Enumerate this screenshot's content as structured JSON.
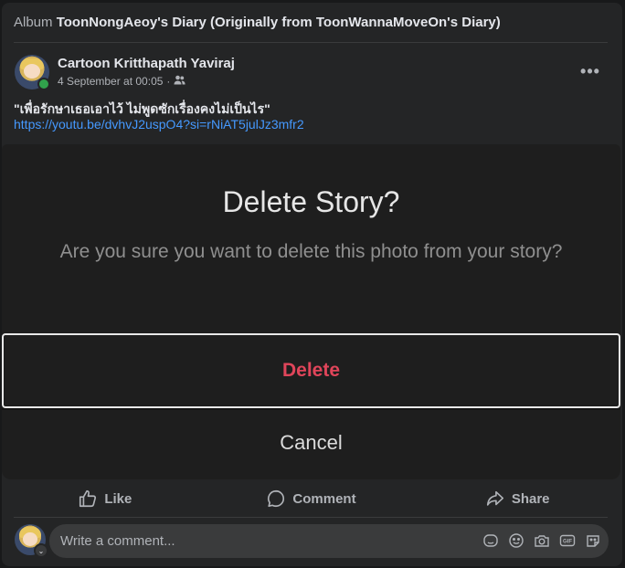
{
  "header": {
    "album_prefix": "Album",
    "album_name": "ToonNongAeoy's Diary (Originally from ToonWannaMoveOn's Diary)"
  },
  "post": {
    "author": "Cartoon Kritthapath Yaviraj",
    "date": "4 September at 00:05",
    "meta_separator": "·",
    "audience_icon": "friends-icon",
    "text": "\"เพื่อรักษาเธอเอาไว้ ไม่พูดซักเรื่องคงไม่เป็นไร\"",
    "link": "https://youtu.be/dvhvJ2uspO4?si=rNiAT5julJz3mfr2",
    "more_label": "•••"
  },
  "dialog": {
    "title": "Delete Story?",
    "message": "Are you sure you want to delete this photo from your story?",
    "delete_label": "Delete",
    "cancel_label": "Cancel",
    "delete_color": "#e0455a"
  },
  "actions": {
    "like": "Like",
    "comment": "Comment",
    "share": "Share"
  },
  "comment": {
    "placeholder": "Write a comment...",
    "icons": [
      "sticker-icon",
      "emoji-icon",
      "camera-icon",
      "gif-icon",
      "avatar-sticker-icon"
    ]
  },
  "colors": {
    "background": "#18191a",
    "card": "#242526",
    "link": "#4599ff",
    "online": "#31a24c"
  }
}
